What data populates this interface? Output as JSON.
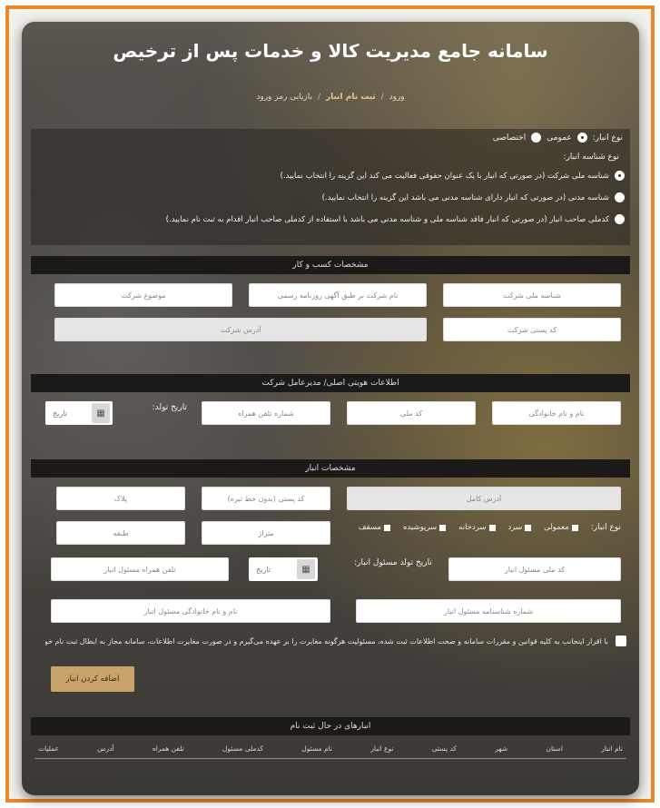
{
  "page": {
    "title": "سامانه جامع مدیریت کالا و خدمات پس از ترخیص",
    "breadcrumb": {
      "item1": "ورود",
      "active": "ثبت نام انبار",
      "item3": "بازیابی رمز ورود"
    }
  },
  "warehouse_type": {
    "label": "نوع انبار:",
    "options": [
      "عمومی",
      "اختصاصی"
    ],
    "selected": "عمومی"
  },
  "id_type": {
    "label": "نوع شناسه انبار:",
    "options": [
      "شناسه ملی شرکت (در صورتی که انبار با یک عنوان حقوقی فعالیت می کند این گزینه را انتخاب نمایید.)",
      "شناسه مدنی (در صورتی که انبار دارای شناسه مدنی می باشد این گزینه را انتخاب نمایید.)",
      "کدملی صاحب انبار (در صورتی که انبار فاقد شناسه ملی و شناسه مدنی می باشد با استفاده از کدملی صاحب انبار اقدام به ثبت نام نمایید.)"
    ]
  },
  "business_section": {
    "header": "مشخصات کسب و کار",
    "national_id_placeholder": "شناسه ملی شرکت",
    "company_name_placeholder": "نام شرکت بر طبق آگهی روزنامه رسمی",
    "company_subject_placeholder": "موضوع شرکت",
    "postal_code_placeholder": "کد پستی شرکت",
    "address_placeholder": "آدرس شرکت"
  },
  "ceo_section": {
    "header": "اطلاعات هویتی اصلی/ مدیرعامل شرکت",
    "full_name_placeholder": "نام و نام خانوادگی",
    "national_code_placeholder": "کد ملی",
    "mobile_placeholder": "شماره تلفن همراه",
    "birth_date_label": "تاریخ تولد:",
    "date_placeholder": "تاریخ"
  },
  "warehouse_section": {
    "header": "مشخصات انبار",
    "full_address_placeholder": "آدرس کامل",
    "postal_code_placeholder": "کد پستی (بدون خط تیره)",
    "plaque_placeholder": "پلاک",
    "category_label": "نوع انبار:",
    "categories": [
      "معمولی",
      "سرد",
      "سردخانه",
      "سرپوشیده",
      "مسقف"
    ],
    "area_placeholder": "متراژ",
    "floor_placeholder": "طبقه",
    "manager_national_code_placeholder": "کد ملی مسئول انبار",
    "manager_birth_label": "تاریخ تولد مسئول انبار:",
    "date_placeholder": "تاریخ",
    "manager_mobile_placeholder": "تلفن همراه مسئول انبار",
    "manager_id_number_placeholder": "شماره شناسنامه مسئول انبار",
    "manager_full_name_placeholder": "نام و نام خانوادگی مسئول انبار"
  },
  "agreement": {
    "text": "با اقرار اینجانب به کلیه قوانین و مقررات سامانه و صحت اطلاعات ثبت شده، مسئولیت هرگونه مغایرت را بر عهده می‌گیرم و در صورت مغایرت اطلاعات، سامانه مجاز به ابطال ثبت نام خواهد بود."
  },
  "submit_button": "اضافه کردن انبار",
  "pending_section": {
    "header": "انبارهای در حال ثبت نام",
    "columns": [
      "نام انبار",
      "استان",
      "شهر",
      "کد پستی",
      "نوع انبار",
      "نام مسئول",
      "کدملی مسئول",
      "تلفن همراه",
      "آدرس",
      "عملیات"
    ]
  },
  "colors": {
    "frame_border": "#e8892a",
    "button_bg": "#c9a46a",
    "section_bar": "#1c1a18"
  }
}
